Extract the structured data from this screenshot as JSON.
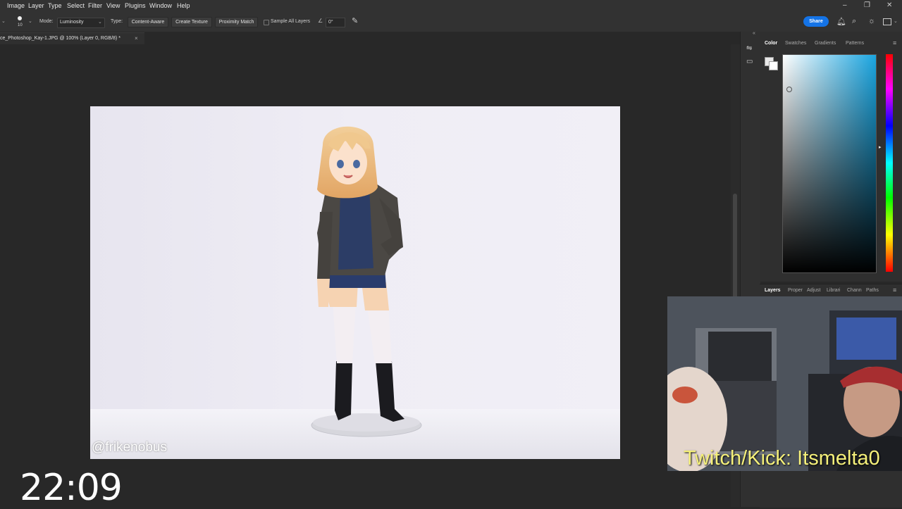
{
  "menu": {
    "items": [
      "Image",
      "Layer",
      "Type",
      "Select",
      "Filter",
      "View",
      "Plugins",
      "Window",
      "Help"
    ]
  },
  "window_controls": [
    "–",
    "❐",
    "✕"
  ],
  "options": {
    "brush_size": "10",
    "mode_label": "Mode:",
    "mode_value": "Luminosity",
    "type_label": "Type:",
    "type_buttons": [
      "Content-Aware",
      "Create Texture",
      "Proximity Match"
    ],
    "sample_all_layers": "Sample All Layers",
    "angle_value": "0°",
    "share_label": "Share"
  },
  "document": {
    "tab_title": "ce_Photoshop_Kay-1.JPG @ 100% (Layer 0, RGB/8) *",
    "tab_close": "×",
    "watermark": "@frikenobus"
  },
  "color_panel": {
    "tabs": [
      "Color",
      "Swatches",
      "Gradients",
      "Patterns"
    ],
    "hue_color": "#1aa5e0"
  },
  "layers_panel": {
    "tabs": [
      "Layers",
      "Proper",
      "Adjust",
      "Librari",
      "Chann",
      "Paths"
    ]
  },
  "webcam": {
    "overlay_text": "Twitch/Kick: Itsmelta0"
  },
  "clock": {
    "time": "22:09"
  },
  "colors": {
    "accent": "#1473e6",
    "overlay_text": "#f5f07a"
  }
}
